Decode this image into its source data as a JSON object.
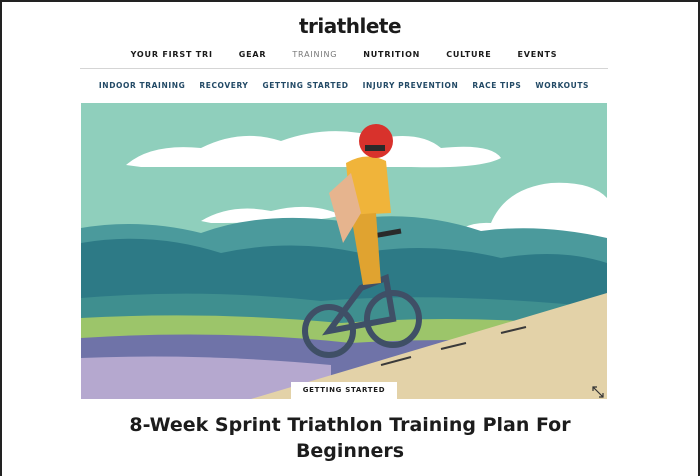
{
  "site": {
    "logo_text": "triathlete"
  },
  "primary_nav": [
    {
      "label": "YOUR FIRST TRI",
      "active": false
    },
    {
      "label": "GEAR",
      "active": false
    },
    {
      "label": "TRAINING",
      "active": true
    },
    {
      "label": "NUTRITION",
      "active": false
    },
    {
      "label": "CULTURE",
      "active": false
    },
    {
      "label": "EVENTS",
      "active": false
    }
  ],
  "secondary_nav": [
    {
      "label": "INDOOR TRAINING"
    },
    {
      "label": "RECOVERY"
    },
    {
      "label": "GETTING STARTED"
    },
    {
      "label": "INJURY PREVENTION"
    },
    {
      "label": "RACE TIPS"
    },
    {
      "label": "WORKOUTS"
    }
  ],
  "article": {
    "category_tag": "GETTING STARTED",
    "title": "8-Week Sprint Triathlon Training Plan For Beginners",
    "hero_icon": "expand-icon"
  },
  "colors": {
    "sky": "#8fcfbc",
    "cloud": "#ffffff",
    "hills_dark": "#2d7a86",
    "hills_mid": "#4b9a9c",
    "field_green": "#9cc56a",
    "field_purple": "#6f73a8",
    "road": "#e3d2a8",
    "jersey": "#f0b43a",
    "helmet": "#d8322c",
    "bike": "#3f4f66",
    "nav_secondary": "#234a66"
  }
}
